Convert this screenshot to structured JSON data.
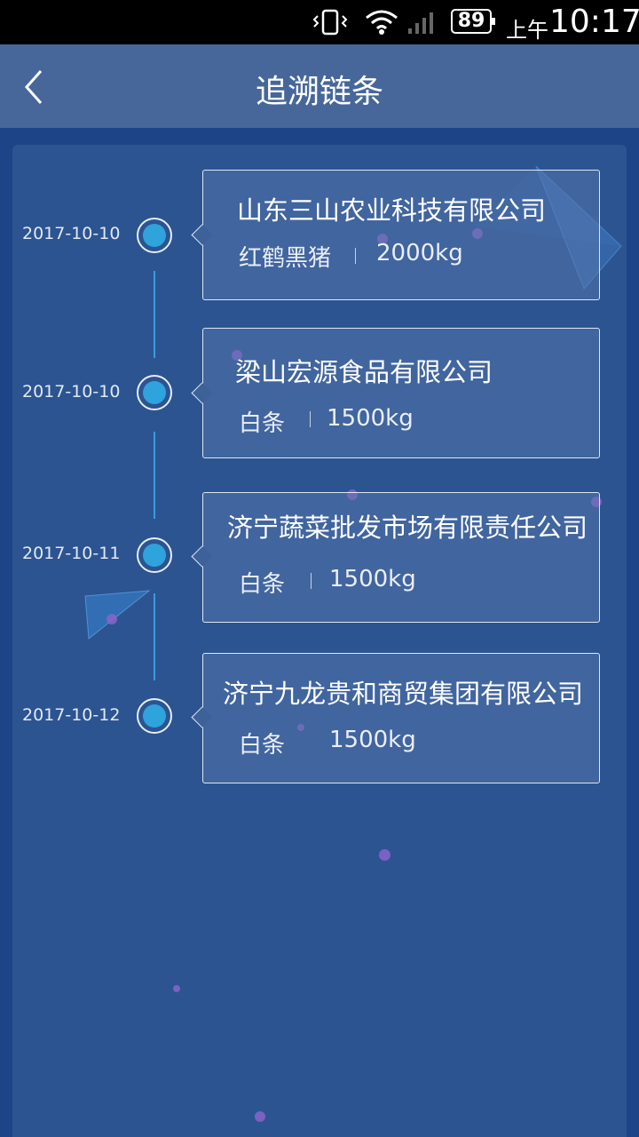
{
  "status_bar": {
    "battery": "89",
    "ampm": "上午",
    "time": "10:17",
    "icons": [
      "vibrate-icon",
      "wifi-icon",
      "signal-icon",
      "battery-icon"
    ]
  },
  "header": {
    "title": "追溯链条",
    "back_icon": "chevron-left-icon"
  },
  "timeline": [
    {
      "date": "2017-10-10",
      "company": "山东三山农业科技有限公司",
      "product": "红鹤黑猪",
      "quantity": "2000kg"
    },
    {
      "date": "2017-10-10",
      "company": "梁山宏源食品有限公司",
      "product": "白条",
      "quantity": "1500kg"
    },
    {
      "date": "2017-10-11",
      "company": "济宁蔬菜批发市场有限责任公司",
      "product": "白条",
      "quantity": "1500kg"
    },
    {
      "date": "2017-10-12",
      "company": "济宁九龙贵和商贸集团有限公司",
      "product": "白条",
      "quantity": "1500kg"
    }
  ],
  "colors": {
    "background": "#1d4486",
    "header": "#47679a",
    "panel": "#2c5491",
    "node": "#2ea3dc",
    "line": "#3a9be0"
  }
}
